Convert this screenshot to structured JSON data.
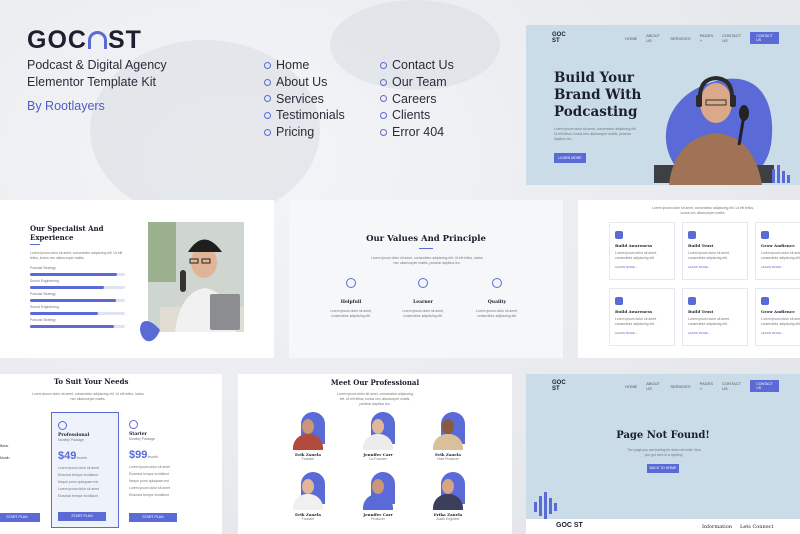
{
  "brand": {
    "logo": "GOC  ST",
    "tagline_1": "Podcast & Digital Agency",
    "tagline_2": "Elementor Template Kit",
    "byline": "By Rootlayers",
    "accent": "#5a6ad6"
  },
  "pages_col1": [
    "Home",
    "About Us",
    "Services",
    "Testimonials",
    "Pricing"
  ],
  "pages_col2": [
    "Contact Us",
    "Our Team",
    "Careers",
    "Clients",
    "Error 404"
  ],
  "hero": {
    "nav_logo": "GOC  ST",
    "nav": [
      "HOME",
      "ABOUT US",
      "SERVICES",
      "PAGES ˅",
      "CONTACT US"
    ],
    "nav_button": "CONTACT US",
    "title_1": "Build Your",
    "title_2": "Brand With",
    "title_3": "Podcasting",
    "text": "Lorem ipsum dolor sit amet, consectetur adipiscing elit. Ut elit tellus, luctus nec ullamcorper mattis, pulvinar dapibus leo.",
    "button": "LEARN MORE"
  },
  "specialist": {
    "title_1": "Our Specialist And",
    "title_2": "Experience",
    "text": "Lorem ipsum dolor sit amet, consectetur adipiscing elit. Ut elit tellus, luctus nec ullamcorper mattis.",
    "skills": [
      {
        "name": "Podcast Strategy",
        "value": 0.92
      },
      {
        "name": "Sound Engineering",
        "value": 0.78
      },
      {
        "name": "Podcast Strategy",
        "value": 0.9
      },
      {
        "name": "Sound Engineering",
        "value": 0.72
      },
      {
        "name": "Podcast Strategy",
        "value": 0.88
      }
    ]
  },
  "values": {
    "title": "Our Values And Principle",
    "text": "Lorem ipsum dolor sit amet, consectetur adipiscing elit. Ut elit tellus, luctus nec ullamcorper mattis, pulvinar dapibus leo.",
    "items": [
      {
        "name": "Helpfull",
        "text": "Lorem ipsum dolor sit amet, consectetur adipiscing elit."
      },
      {
        "name": "Learner",
        "text": "Lorem ipsum dolor sit amet, consectetur adipiscing elit."
      },
      {
        "name": "Quality",
        "text": "Lorem ipsum dolor sit amet, consectetur adipiscing elit."
      }
    ]
  },
  "services": {
    "text": "Lorem ipsum dolor sit amet, consectetur adipiscing elit. Ut elit tellus, luctus nec ullamcorper mattis.",
    "items": [
      {
        "name": "Build Awareness",
        "link": "LEARN MORE ›"
      },
      {
        "name": "Build Trust",
        "link": "LEARN MORE ›"
      },
      {
        "name": "Grow Audience",
        "link": "LEARN MORE ›"
      },
      {
        "name": "Build Awareness",
        "link": "LEARN MORE ›"
      },
      {
        "name": "Build Trust",
        "link": "LEARN MORE ›"
      },
      {
        "name": "Grow Audience",
        "link": "LEARN MORE ›"
      }
    ],
    "item_text": "Lorem ipsum dolor sit amet, consectetur adipiscing elit."
  },
  "pricing": {
    "title": "To Suit Your Needs",
    "text": "Lorem ipsum dolor sit amet, consectetur adipiscing elit. Ut elit tellus, luctus nec ullamcorper mattis.",
    "plans": [
      {
        "name": "Professional",
        "sub": "Monthly Package",
        "price": "$49",
        "per": "/month",
        "button": "START PLAN"
      },
      {
        "name": "Starter",
        "sub": "Monthly Package",
        "price": "$99",
        "per": "/month",
        "button": "START PLAN"
      }
    ],
    "left_button": "START PLAN",
    "left_labels": [
      "Basic",
      "Month"
    ],
    "features": [
      "Lorem ipsum dolor sit amet",
      "Eiusmod tempor incididunt",
      "Neque porro quisquam est",
      "Lorem ipsum dolor sit amet",
      "Eiusmod tempor incididunt"
    ]
  },
  "team": {
    "title": "Meet Our Professional",
    "text": "Lorem ipsum dolor sit amet, consectetur adipiscing elit. Ut elit tellus, luctus nec ullamcorper mattis, pulvinar dapibus leo.",
    "members": [
      {
        "name": "Erik Zanela",
        "role": "Founder"
      },
      {
        "name": "Jennifer Carr",
        "role": "Co-Founder"
      },
      {
        "name": "Erik Zanela",
        "role": "Host Producer"
      },
      {
        "name": "Erik Zanela",
        "role": "Founder"
      },
      {
        "name": "Jennifer Carr",
        "role": "Producer"
      },
      {
        "name": "Erika Zanela",
        "role": "Audio Engineer"
      }
    ]
  },
  "notfound": {
    "nav_logo": "GOC  ST",
    "nav": [
      "HOME",
      "ABOUT US",
      "SERVICES",
      "PAGES ˅",
      "CONTACT US"
    ],
    "nav_button": "CONTACT US",
    "title": "Page Not Found!",
    "text": "The page you are looking for does not exist. How you got here is a mystery.",
    "button": "BACK TO HOME",
    "footer_logo": "GOC  ST",
    "footer_cols": [
      "Information",
      "Lets Connect"
    ]
  }
}
